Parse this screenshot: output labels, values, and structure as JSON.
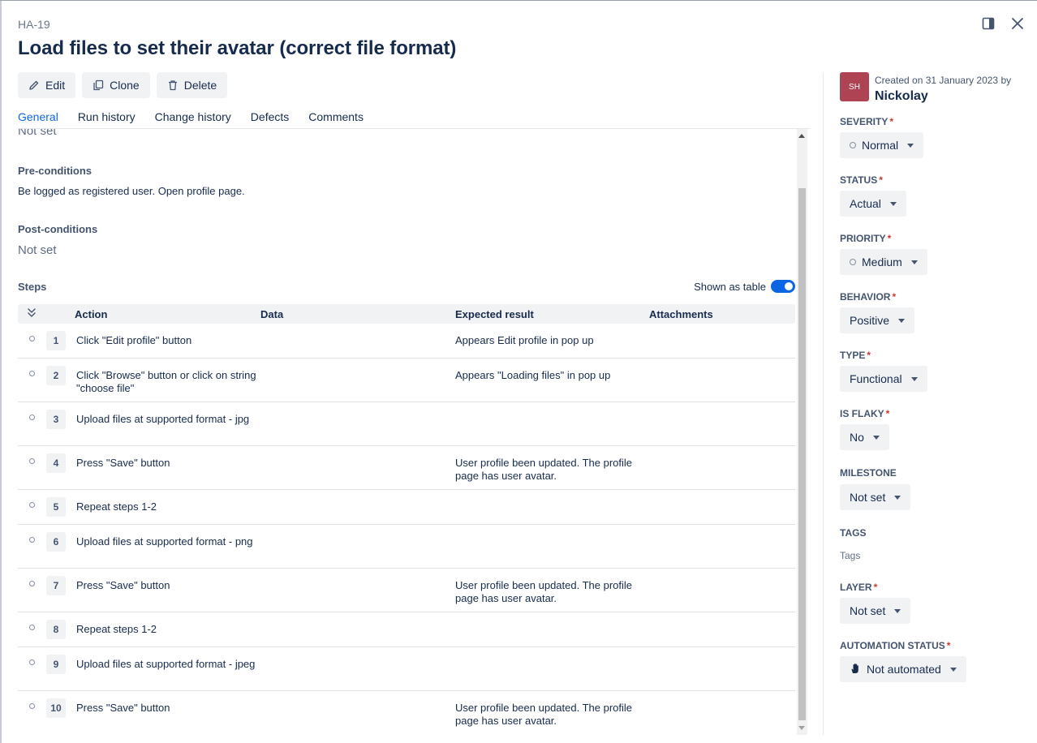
{
  "header": {
    "issue_key": "HA-19",
    "title": "Load files to set their avatar (correct file format)"
  },
  "toolbar": {
    "edit_label": "Edit",
    "clone_label": "Clone",
    "delete_label": "Delete"
  },
  "tabs": [
    {
      "label": "General",
      "active": true
    },
    {
      "label": "Run history",
      "active": false
    },
    {
      "label": "Change history",
      "active": false
    },
    {
      "label": "Defects",
      "active": false
    },
    {
      "label": "Comments",
      "active": false
    }
  ],
  "general": {
    "cut_off_value": "Not set",
    "preconditions_label": "Pre-conditions",
    "preconditions_value": "Be logged as registered user. Open profile page.",
    "postconditions_label": "Post-conditions",
    "postconditions_value": "Not set",
    "steps_label": "Steps",
    "shown_as_table_label": "Shown as table",
    "shown_as_table_on": true
  },
  "steps_table": {
    "columns": {
      "action": "Action",
      "data": "Data",
      "expected": "Expected result",
      "attachments": "Attachments"
    },
    "rows": [
      {
        "num": "1",
        "action": "Click \"Edit profile\" button",
        "expected": "Appears Edit profile in pop up"
      },
      {
        "num": "2",
        "action": "Click \"Browse\" button or click on string \"choose file\"",
        "expected": "Appears \"Loading files\" in pop up"
      },
      {
        "num": "3",
        "action": "Upload files at supported format - jpg",
        "expected": ""
      },
      {
        "num": "4",
        "action": "Press \"Save\" button",
        "expected": "User profile been updated. The profile page has user avatar."
      },
      {
        "num": "5",
        "action": "Repeat steps 1-2",
        "expected": ""
      },
      {
        "num": "6",
        "action": "Upload files at supported format - png",
        "expected": ""
      },
      {
        "num": "7",
        "action": "Press \"Save\" button",
        "expected": "User profile been updated. The profile page has user avatar."
      },
      {
        "num": "8",
        "action": "Repeat steps 1-2",
        "expected": ""
      },
      {
        "num": "9",
        "action": "Upload files at supported format - jpeg",
        "expected": ""
      },
      {
        "num": "10",
        "action": "Press \"Save\" button",
        "expected": "User profile been updated. The profile page has user avatar."
      }
    ]
  },
  "sidebar": {
    "avatar_initials": "SH",
    "created_text": "Created on 31 January 2023 by",
    "author": "Nickolay",
    "fields": {
      "severity": {
        "label": "SEVERITY",
        "value": "Normal"
      },
      "status": {
        "label": "STATUS",
        "value": "Actual"
      },
      "priority": {
        "label": "PRIORITY",
        "value": "Medium"
      },
      "behavior": {
        "label": "BEHAVIOR",
        "value": "Positive"
      },
      "type": {
        "label": "TYPE",
        "value": "Functional"
      },
      "is_flaky": {
        "label": "IS FLAKY",
        "value": "No"
      },
      "milestone": {
        "label": "MILESTONE",
        "value": "Not set"
      },
      "tags": {
        "label": "TAGS",
        "placeholder": "Tags"
      },
      "layer": {
        "label": "LAYER",
        "value": "Not set"
      },
      "automation_status": {
        "label": "AUTOMATION STATUS",
        "value": "Not automated"
      }
    }
  },
  "colors": {
    "accent": "#0c66e4",
    "required": "#c9372c",
    "avatar_bg": "#ae4354"
  },
  "icons": [
    "panel-toggle-icon",
    "close-icon",
    "pencil-icon",
    "copy-icon",
    "trash-icon",
    "collapse-all-icon",
    "hand-icon",
    "chevron-down-icon"
  ]
}
